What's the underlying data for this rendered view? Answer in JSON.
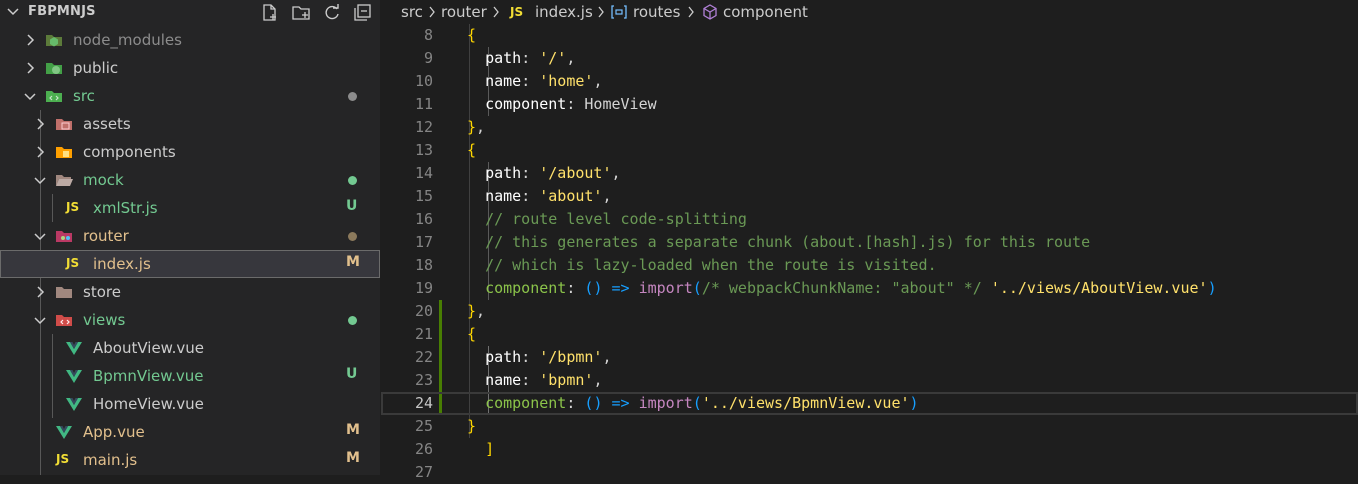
{
  "explorer": {
    "title": "FBPMNJS",
    "header_icons": [
      "new-file-icon",
      "new-folder-icon",
      "refresh-icon",
      "collapse-all-icon"
    ],
    "items": [
      {
        "label": "node_modules",
        "kind": "folder",
        "status": ""
      },
      {
        "label": "public",
        "kind": "folder",
        "status": ""
      },
      {
        "label": "src",
        "kind": "folder",
        "status": "dot"
      },
      {
        "label": "assets",
        "kind": "folder",
        "status": ""
      },
      {
        "label": "components",
        "kind": "folder",
        "status": ""
      },
      {
        "label": "mock",
        "kind": "folder",
        "status": "dot"
      },
      {
        "label": "xmlStr.js",
        "kind": "file",
        "status": "U",
        "icon_text": "JS"
      },
      {
        "label": "router",
        "kind": "folder",
        "status": "dot"
      },
      {
        "label": "index.js",
        "kind": "file",
        "status": "M",
        "icon_text": "JS"
      },
      {
        "label": "store",
        "kind": "folder",
        "status": ""
      },
      {
        "label": "views",
        "kind": "folder",
        "status": "dot"
      },
      {
        "label": "AboutView.vue",
        "kind": "file",
        "status": ""
      },
      {
        "label": "BpmnView.vue",
        "kind": "file",
        "status": "U"
      },
      {
        "label": "HomeView.vue",
        "kind": "file",
        "status": ""
      },
      {
        "label": "App.vue",
        "kind": "file",
        "status": "M"
      },
      {
        "label": "main.js",
        "kind": "file",
        "status": "M",
        "icon_text": "JS"
      }
    ]
  },
  "breadcrumb": {
    "items": [
      "src",
      "router",
      "index.js",
      "routes",
      "component"
    ],
    "file_icon_text": "JS"
  },
  "editor": {
    "lines": [
      {
        "n": "8",
        "text": "    {"
      },
      {
        "n": "9",
        "text": "      path: '/',"
      },
      {
        "n": "10",
        "text": "      name: 'home',"
      },
      {
        "n": "11",
        "text": "      component: HomeView"
      },
      {
        "n": "12",
        "text": "    },"
      },
      {
        "n": "13",
        "text": "    {"
      },
      {
        "n": "14",
        "text": "      path: '/about',"
      },
      {
        "n": "15",
        "text": "      name: 'about',"
      },
      {
        "n": "16",
        "text": "      // route level code-splitting"
      },
      {
        "n": "17",
        "text": "      // this generates a separate chunk (about.[hash].js) for this route"
      },
      {
        "n": "18",
        "text": "      // which is lazy-loaded when the route is visited."
      },
      {
        "n": "19",
        "text": "      component: () => import(/* webpackChunkName: \"about\" */ '../views/AboutView.vue')"
      },
      {
        "n": "20",
        "text": "    },"
      },
      {
        "n": "21",
        "text": "    {"
      },
      {
        "n": "22",
        "text": "      path: '/bpmn',"
      },
      {
        "n": "23",
        "text": "      name: 'bpmn',"
      },
      {
        "n": "24",
        "text": "      component: () => import('../views/BpmnView.vue')"
      },
      {
        "n": "25",
        "text": "    }"
      },
      {
        "n": "26",
        "text": "  ]"
      },
      {
        "n": "27",
        "text": ""
      }
    ],
    "active_line": "24"
  },
  "colors": {
    "modified": "#e2c08d",
    "untracked": "#73c991",
    "git_added": "#487e02",
    "js_icon": "#f1dd35",
    "vue_icon": "#41b883"
  }
}
